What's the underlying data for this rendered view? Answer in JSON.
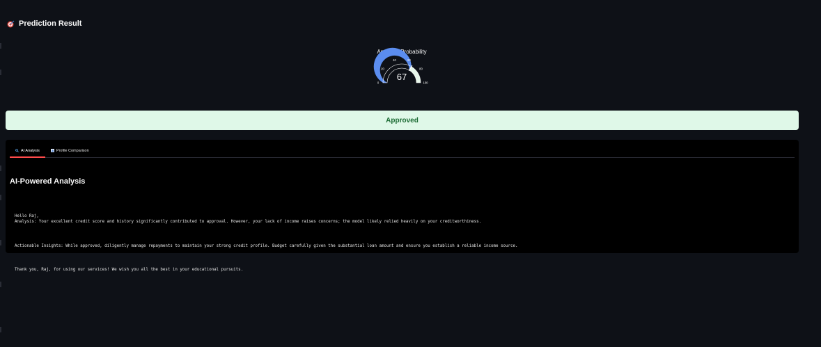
{
  "section": {
    "title": "Prediction Result",
    "icon": "target-icon"
  },
  "gauge": {
    "title": "Approval Probability",
    "value": 67,
    "value_label": "67",
    "min": 0,
    "max": 100,
    "tick_labels": [
      "0",
      "20",
      "40",
      "60",
      "80",
      "100"
    ],
    "colors": {
      "filled": "#5b8def",
      "remaining": "#e7f7ea",
      "threshold": "#ffffff"
    }
  },
  "result": {
    "label": "Approved",
    "bg": "#dff8e8",
    "fg": "#1b6b33"
  },
  "tabs": [
    {
      "label": "AI Analysis",
      "icon": "magnifier-icon",
      "active": true
    },
    {
      "label": "Profile Comparison",
      "icon": "bar-chart-icon",
      "active": false
    }
  ],
  "analysis": {
    "heading": "AI-Powered Analysis",
    "greeting": "Hello Raj,",
    "analysis_line": "Analysis: Your excellent credit score and history significantly contributed to approval. However, your lack of income raises concerns; the model likely relied heavily on your creditworthiness.",
    "insights_line": "Actionable Insights: While approved, diligently manage repayments to maintain your strong credit profile. Budget carefully given the substantial loan amount and ensure you establish a reliable income source.",
    "closing_line": "Thank you, Raj, for using our services! We wish you all the best in your educational pursuits."
  },
  "theme": {
    "background": "#0e1117",
    "panel": "#000000",
    "accent": "#ff4b4b"
  }
}
